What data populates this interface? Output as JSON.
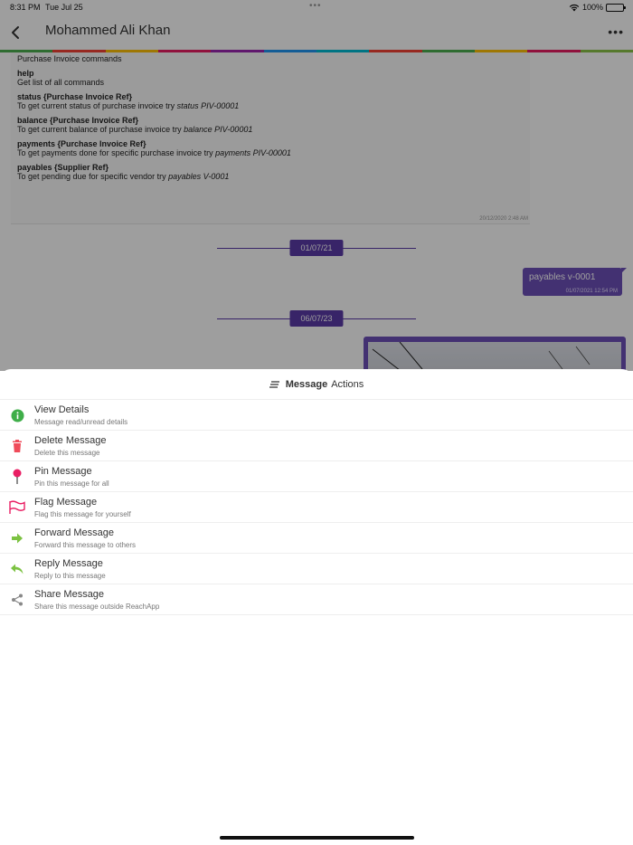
{
  "status_bar": {
    "time": "8:31 PM",
    "date": "Tue Jul 25",
    "battery_text": "100%",
    "dots": "•••"
  },
  "header": {
    "title": "Mohammed Ali Khan",
    "more": "•••"
  },
  "rainbow_colors": [
    "#4caf50",
    "#f44336",
    "#ffc107",
    "#e91e63",
    "#9c27b0",
    "#2196f3",
    "#00bcd4",
    "#f44336",
    "#4caf50",
    "#ffc107",
    "#e91e63",
    "#8bc34a"
  ],
  "chat": {
    "bot_card": {
      "heading": "Purchase Invoice commands",
      "commands": [
        {
          "name": "help",
          "desc": "Get list of all commands",
          "example": ""
        },
        {
          "name": "status {Purchase Invoice Ref}",
          "desc": "To get current status of purchase invoice try ",
          "example": "status PIV-00001"
        },
        {
          "name": "balance {Purchase Invoice Ref}",
          "desc": "To get current balance of purchase invoice try ",
          "example": "balance PIV-00001"
        },
        {
          "name": "payments {Purchase Invoice Ref}",
          "desc": "To get payments done for specific purchase invoice try ",
          "example": "payments PIV-00001"
        },
        {
          "name": "payables {Supplier Ref}",
          "desc": "To get pending due for specific vendor try ",
          "example": "payables V-0001"
        }
      ],
      "timestamp": "20/12/2020 2:48 AM"
    },
    "date_separators": [
      "01/07/21",
      "06/07/23"
    ],
    "outgoing": {
      "text": "payables v-0001",
      "timestamp": "01/07/2021 12:54 PM"
    }
  },
  "sheet": {
    "title_bold": "Message",
    "title_rest": "Actions",
    "actions": [
      {
        "label": "View Details",
        "sub": "Message read/unread details",
        "icon": "info-icon",
        "color": "#3fae49"
      },
      {
        "label": "Delete Message",
        "sub": "Delete this message",
        "icon": "trash-icon",
        "color": "#ef4b5a"
      },
      {
        "label": "Pin Message",
        "sub": "Pin this message for all",
        "icon": "pin-icon",
        "color": "#e91e63"
      },
      {
        "label": "Flag Message",
        "sub": "Flag this message for yourself",
        "icon": "flag-icon",
        "color": "#e91e63"
      },
      {
        "label": "Forward Message",
        "sub": "Forward this message to others",
        "icon": "forward-arrow-icon",
        "color": "#7cc242"
      },
      {
        "label": "Reply Message",
        "sub": "Reply to this message",
        "icon": "reply-icon",
        "color": "#7cc242"
      },
      {
        "label": "Share Message",
        "sub": "Share this message outside ReachApp",
        "icon": "share-icon",
        "color": "#888888"
      }
    ]
  }
}
